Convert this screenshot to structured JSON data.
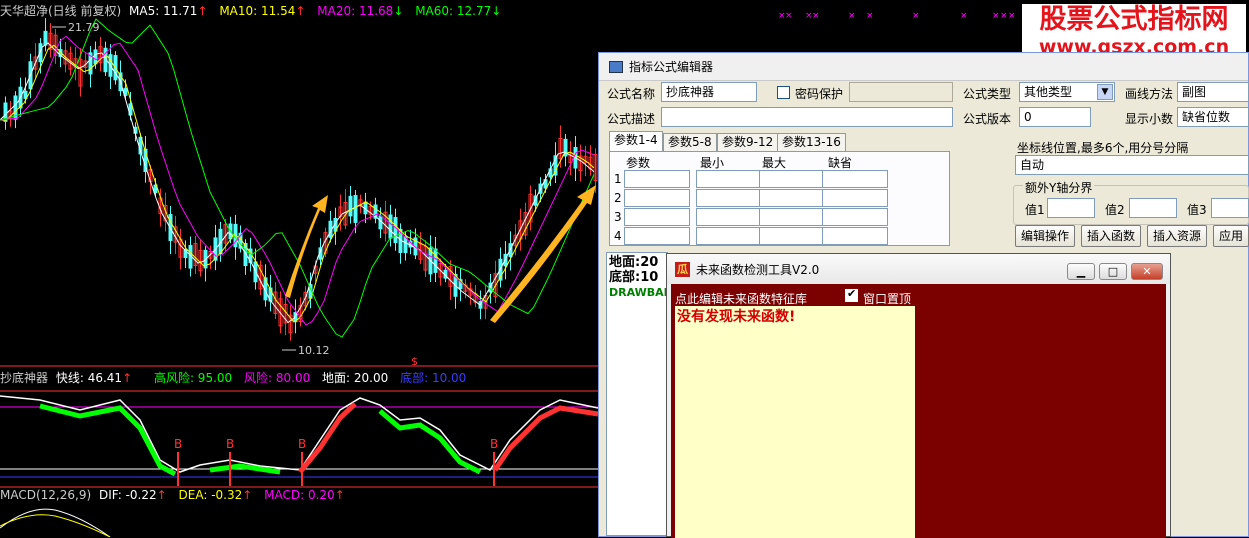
{
  "header": {
    "title": "天华超净(日线 前复权)",
    "ma5": "MA5: 11.71",
    "ma10": "MA10: 11.54",
    "ma20": "MA20: 11.68",
    "ma60": "MA60: 12.77",
    "high_label": "21.79",
    "low_label": "10.12"
  },
  "indicator": {
    "name": "抄底神器",
    "fast": "快线: 46.41",
    "high_risk": "高风险: 95.00",
    "risk": "风险: 80.00",
    "ground": "地面: 20.00",
    "bottom": "底部: 10.00",
    "b_label": "B",
    "dollar": "$"
  },
  "macd": {
    "name": "MACD(12,26,9)",
    "dif": "DIF: -0.22",
    "dea": "DEA: -0.32",
    "macd": "MACD: 0.20"
  },
  "logo": {
    "line1": "股票公式指标网",
    "line2": "www.gszx.com.cn"
  },
  "editor": {
    "title": "指标公式编辑器",
    "name_label": "公式名称",
    "name_value": "抄底神器",
    "pwd_label": "密码保护",
    "type_label": "公式类型",
    "type_value": "其他类型",
    "draw_label": "画线方法",
    "draw_value": "副图",
    "desc_label": "公式描述",
    "version_label": "公式版本",
    "version_value": "0",
    "decimal_label": "显示小数",
    "decimal_value": "缺省位数",
    "tabs": [
      "参数1-4",
      "参数5-8",
      "参数9-12",
      "参数13-16"
    ],
    "col_headers": [
      "参数",
      "最小",
      "最大",
      "缺省"
    ],
    "row_nums": [
      "1",
      "2",
      "3",
      "4"
    ],
    "coord_label": "坐标线位置,最多6个,用分号分隔",
    "coord_value": "自动",
    "yaxis_label": "额外Y轴分界",
    "val1": "值1",
    "val2": "值2",
    "val3": "值3",
    "buttons": [
      "编辑操作",
      "插入函数",
      "插入资源",
      "应用"
    ],
    "code_lines": [
      "地面:20",
      "底部:10",
      "DRAWBANI"
    ]
  },
  "tool": {
    "title": "未来函数检测工具V2.0",
    "note": "点此编辑未来函数特征库",
    "pin_label": "窗口置顶",
    "result": "没有发现未来函数!",
    "icon_char": "瓜"
  },
  "colors": {
    "ma5": "#ffffff",
    "ma10": "#ffff00",
    "ma20": "#ff00ff",
    "ma60": "#00ff00",
    "up": "#ff3232",
    "down": "#54fcfc",
    "risk_bg": "#7b0000"
  }
}
